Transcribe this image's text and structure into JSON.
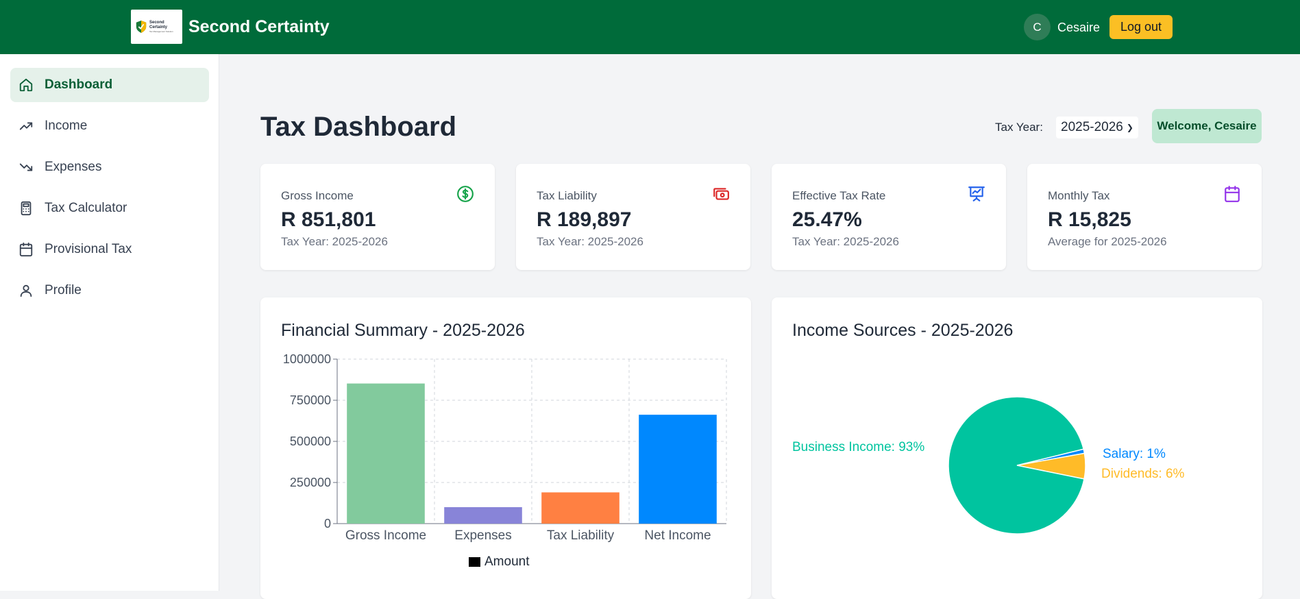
{
  "header": {
    "logo_line1": "Second",
    "logo_line2": "Certainty",
    "logo_tagline": "Tax Management Solution",
    "brand": "Second Certainty",
    "avatar_initial": "C",
    "username": "Cesaire",
    "logout_label": "Log out",
    "color": "#006b3a"
  },
  "sidebar": {
    "items": [
      {
        "label": "Dashboard",
        "icon": "home-icon",
        "active": true
      },
      {
        "label": "Income",
        "icon": "trending-up-icon"
      },
      {
        "label": "Expenses",
        "icon": "trending-down-icon"
      },
      {
        "label": "Tax Calculator",
        "icon": "calculator-icon"
      },
      {
        "label": "Provisional Tax",
        "icon": "calendar-icon"
      },
      {
        "label": "Profile",
        "icon": "user-icon"
      }
    ]
  },
  "main": {
    "title": "Tax Dashboard",
    "tax_year_label": "Tax Year:",
    "tax_year_value": "2025-2026",
    "welcome": "Welcome, Cesaire",
    "stats": [
      {
        "label": "Gross Income",
        "value": "R 851,801",
        "sub": "Tax Year: 2025-2026",
        "icon": "dollar-circle-icon",
        "color": "#16a34a"
      },
      {
        "label": "Tax Liability",
        "value": "R 189,897",
        "sub": "Tax Year: 2025-2026",
        "icon": "money-icon",
        "color": "#dc2626"
      },
      {
        "label": "Effective Tax Rate",
        "value": "25.47%",
        "sub": "Tax Year: 2025-2026",
        "icon": "presentation-chart-icon",
        "color": "#2563eb"
      },
      {
        "label": "Monthly Tax",
        "value": "R 15,825",
        "sub": "Average for 2025-2026",
        "icon": "calendar-icon",
        "color": "#9333ea"
      }
    ]
  },
  "chart_data": [
    {
      "type": "bar",
      "title": "Financial Summary - 2025-2026",
      "categories": [
        "Gross Income",
        "Expenses",
        "Tax Liability",
        "Net Income"
      ],
      "series": [
        {
          "name": "Amount",
          "values": [
            851801,
            100000,
            189897,
            661904
          ]
        }
      ],
      "bar_colors": [
        "#82ca9d",
        "#8884d8",
        "#ff8042",
        "#0088fe"
      ],
      "yticks": [
        "0",
        "250000",
        "500000",
        "750000",
        "1000000"
      ],
      "ylim": [
        0,
        1000000
      ],
      "grid": true,
      "legend": "bottom"
    },
    {
      "type": "pie",
      "title": "Income Sources - 2025-2026",
      "slices": [
        {
          "label": "Business Income: 93%",
          "value": 93,
          "color": "#00c49f"
        },
        {
          "label": "Salary: 1%",
          "value": 1,
          "color": "#0088fe"
        },
        {
          "label": "Dividends: 6%",
          "value": 6,
          "color": "#ffbb28"
        }
      ]
    }
  ]
}
